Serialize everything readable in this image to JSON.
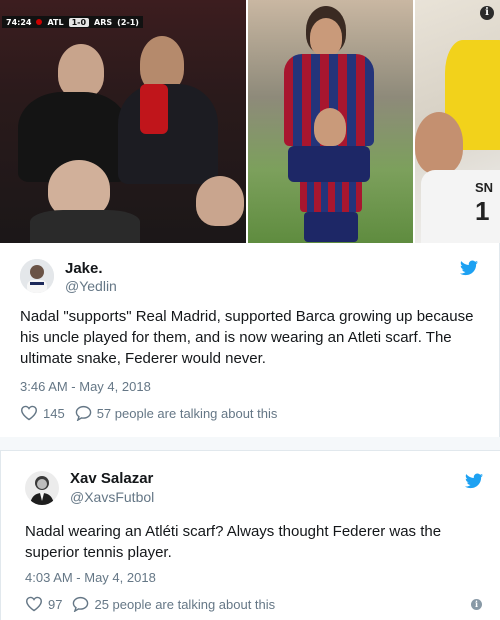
{
  "media": {
    "score": {
      "time": "74:24",
      "home": "ATL",
      "result": "1-0",
      "away": "ARS",
      "aggregate": "(2-1)"
    },
    "info_glyph": "i",
    "jersey_text_partial": "SN",
    "jersey_number_partial": "1"
  },
  "tweets": [
    {
      "name": "Jake.",
      "handle": "@Yedlin",
      "text": "Nadal \"supports\" Real Madrid, supported Barca growing up because his uncle played for them, and is now wearing an Atleti scarf. The ultimate snake, Federer would never.",
      "time": "3:46 AM - May 4, 2018",
      "likes": "145",
      "talking": "57 people are talking about this"
    },
    {
      "name": "Xav Salazar",
      "handle": "@XavsFutbol",
      "text": "Nadal wearing an Atléti scarf? Always thought Federer was the superior tennis player.",
      "time": "4:03 AM - May 4, 2018",
      "likes": "97",
      "talking": "25 people are talking about this",
      "info_glyph": "i"
    }
  ],
  "colors": {
    "twitter_blue": "#1da1f2",
    "meta_gray": "#657786",
    "text": "#14171a"
  }
}
